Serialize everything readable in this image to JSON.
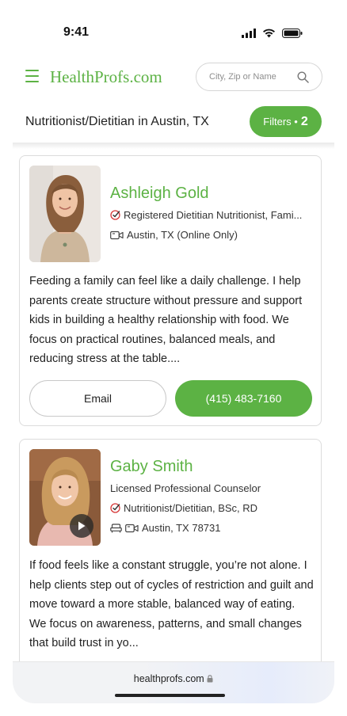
{
  "status_bar": {
    "time": "9:41"
  },
  "header": {
    "logo": "HealthProfs.com",
    "search_placeholder": "City, Zip or Name"
  },
  "title_row": {
    "title": "Nutritionist/Dietitian in Austin, TX",
    "filters_label": "Filters •",
    "filters_count": "2"
  },
  "profiles": [
    {
      "name": "Ashleigh Gold",
      "credential": "Registered Dietitian Nutritionist, Fami...",
      "location": "Austin, TX (Online Only)",
      "bio": "Feeding a family can feel like a daily challenge. I help parents create structure without pressure and support kids in building a healthy relationship with food. We focus on practical routines, balanced meals, and reducing stress at the table....",
      "email_label": "Email",
      "phone_label": "(415) 483-7160"
    },
    {
      "name": "Gaby Smith",
      "title": "Licensed Professional Counselor",
      "credential": "Nutritionist/Dietitian, BSc, RD",
      "location": "Austin, TX 78731",
      "bio": "If food feels like a constant struggle, you’re not alone. I help clients step out of cycles of restriction and guilt and move toward a more stable, balanced way of eating. We focus on awareness, patterns, and small changes that build trust in yo..."
    }
  ],
  "browser": {
    "url": "healthprofs.com"
  },
  "colors": {
    "brand_green": "#5cb244"
  }
}
